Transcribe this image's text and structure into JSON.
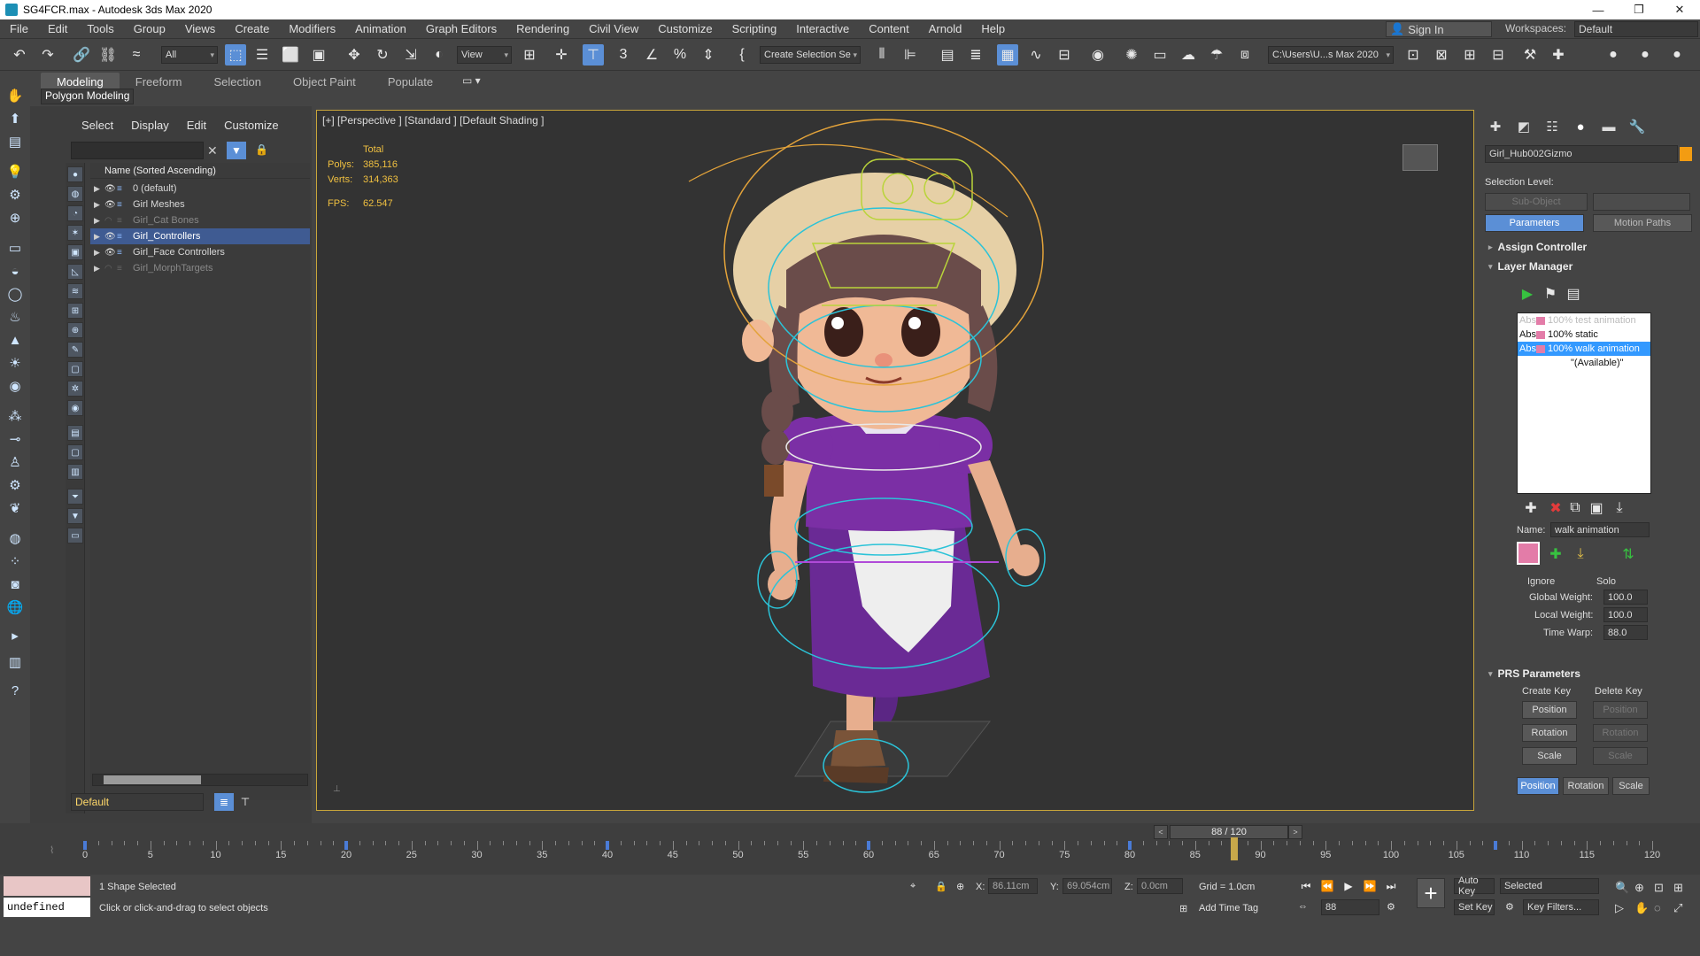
{
  "window": {
    "title": "SG4FCR.max - Autodesk 3ds Max 2020",
    "controls": [
      "—",
      "❐",
      "✕"
    ]
  },
  "menu": [
    "File",
    "Edit",
    "Tools",
    "Group",
    "Views",
    "Create",
    "Modifiers",
    "Animation",
    "Graph Editors",
    "Rendering",
    "Civil View",
    "Customize",
    "Scripting",
    "Interactive",
    "Content",
    "Arnold",
    "Help"
  ],
  "signin": "Sign In",
  "workspaces": {
    "label": "Workspaces:",
    "value": "Default"
  },
  "toolbar": {
    "filter": "All",
    "ref_coord": "View",
    "selection_set": "Create Selection Se",
    "project_path": "C:\\Users\\U...s Max 2020"
  },
  "ribbon": {
    "tabs": [
      "Modeling",
      "Freeform",
      "Selection",
      "Object Paint",
      "Populate"
    ],
    "active_tab": "Modeling",
    "sub_panel": "Polygon Modeling"
  },
  "scene_explorer": {
    "menu": [
      "Select",
      "Display",
      "Edit",
      "Customize"
    ],
    "header": "Name (Sorted Ascending)",
    "rows": [
      {
        "label": "0 (default)",
        "dim": false,
        "selected": false
      },
      {
        "label": "Girl Meshes",
        "dim": false,
        "selected": false
      },
      {
        "label": "Girl_Cat Bones",
        "dim": true,
        "selected": false
      },
      {
        "label": "Girl_Controllers",
        "dim": false,
        "selected": true
      },
      {
        "label": "Girl_Face Controllers",
        "dim": false,
        "selected": false
      },
      {
        "label": "Girl_MorphTargets",
        "dim": true,
        "selected": false
      }
    ],
    "layer": "Default"
  },
  "viewport": {
    "label": "[+] [Perspective ] [Standard ] [Default Shading ]",
    "stats": {
      "header": "Total",
      "polys_label": "Polys:",
      "polys": "385,116",
      "verts_label": "Verts:",
      "verts": "314,363",
      "fps_label": "FPS:",
      "fps": "62.547"
    }
  },
  "command_panel": {
    "object_name": "Girl_Hub002Gizmo",
    "object_color": "#f39c12",
    "selection_level_label": "Selection Level:",
    "sub_object": "Sub-Object",
    "parameters_btn": "Parameters",
    "motion_paths_btn": "Motion Paths",
    "assign_controller": "Assign Controller",
    "layer_manager": "Layer Manager",
    "layers": [
      {
        "text": "100% test animation",
        "prefix": "Abs",
        "dim": true,
        "selected": false
      },
      {
        "text": "100% static",
        "prefix": "Abs",
        "dim": false,
        "selected": false
      },
      {
        "text": "100% walk animation",
        "prefix": "Abs",
        "dim": false,
        "selected": true
      },
      {
        "text": "\"(Available)\"",
        "prefix": "",
        "dim": false,
        "selected": false
      }
    ],
    "name_label": "Name:",
    "name_value": "walk animation",
    "ignore_label": "Ignore",
    "solo_label": "Solo",
    "global_weight_label": "Global Weight:",
    "global_weight": "100.0",
    "local_weight_label": "Local Weight:",
    "local_weight": "100.0",
    "time_warp_label": "Time Warp:",
    "time_warp": "88.0",
    "prs_params": "PRS Parameters",
    "create_key": "Create Key",
    "delete_key": "Delete Key",
    "keys": [
      "Position",
      "Rotation",
      "Scale"
    ],
    "bottom_tabs": [
      "Position",
      "Rotation",
      "Scale"
    ]
  },
  "timeline": {
    "current": "88 / 120",
    "ticks": [
      "0",
      "5",
      "10",
      "15",
      "20",
      "25",
      "30",
      "35",
      "40",
      "45",
      "50",
      "55",
      "60",
      "65",
      "70",
      "75",
      "80",
      "85",
      "90",
      "95",
      "100",
      "105",
      "110",
      "115",
      "120"
    ],
    "current_frame": 88
  },
  "status": {
    "maxscript": "undefined",
    "selected": "1 Shape Selected",
    "prompt": "Click or click-and-drag to select objects",
    "x_label": "X:",
    "x": "86.11cm",
    "y_label": "Y:",
    "y": "69.054cm",
    "z_label": "Z:",
    "z": "0.0cm",
    "grid": "Grid = 1.0cm",
    "add_time_tag": "Add Time Tag",
    "auto_key": "Auto Key",
    "set_key": "Set Key",
    "key_mode": "Selected",
    "key_filters": "Key Filters...",
    "frame": "88"
  }
}
